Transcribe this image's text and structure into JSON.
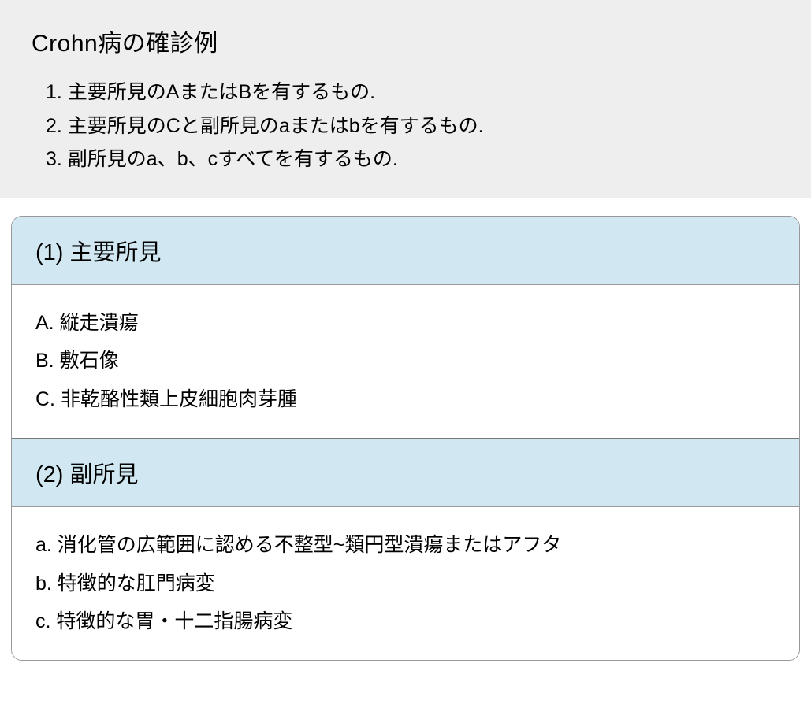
{
  "top": {
    "title": "Crohn病の確診例",
    "criteria": [
      "1. 主要所見のAまたはBを有するもの.",
      "2. 主要所見のCと副所見のaまたはbを有するもの.",
      "3. 副所見のa、b、cすべてを有するもの."
    ]
  },
  "sections": [
    {
      "header": "(1) 主要所見",
      "items": [
        "A. 縦走潰瘍",
        "B. 敷石像",
        "C. 非乾酪性類上皮細胞肉芽腫"
      ]
    },
    {
      "header": "(2) 副所見",
      "items": [
        "a. 消化管の広範囲に認める不整型~類円型潰瘍またはアフタ",
        "b. 特徴的な肛門病変",
        "c. 特徴的な胃・十二指腸病変"
      ]
    }
  ]
}
